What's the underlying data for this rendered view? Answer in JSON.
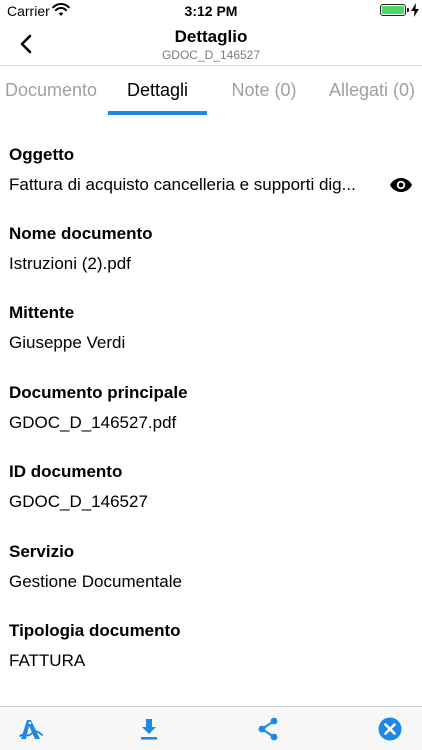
{
  "status_bar": {
    "carrier": "Carrier",
    "time": "3:12 PM",
    "battery_level": 1.0
  },
  "nav": {
    "title": "Dettaglio",
    "subtitle": "GDOC_D_146527",
    "back_icon": "chevron-left-icon"
  },
  "tabs": [
    {
      "label": "Documento"
    },
    {
      "label": "Dettagli"
    },
    {
      "label": "Note (0)"
    },
    {
      "label": "Allegati (0)"
    }
  ],
  "active_tab": "Dettagli",
  "fields": [
    {
      "label": "Oggetto",
      "value": "Fattura di acquisto cancelleria e supporti dig..."
    },
    {
      "label": "Nome documento",
      "value": "Istruzioni (2).pdf"
    },
    {
      "label": "Mittente",
      "value": "Giuseppe Verdi"
    },
    {
      "label": "Documento principale",
      "value": "GDOC_D_146527.pdf"
    },
    {
      "label": "ID documento",
      "value": "GDOC_D_146527"
    },
    {
      "label": "Servizio",
      "value": "Gestione Documentale"
    },
    {
      "label": "Tipologia documento",
      "value": "FATTURA"
    }
  ],
  "toolbar": {
    "icons": [
      "sign-icon",
      "download-icon",
      "share-icon",
      "close-circle-icon"
    ]
  },
  "colors": {
    "accent": "#1e88e5",
    "inactive_tab": "#a0a0a0",
    "battery": "#4cd964"
  }
}
